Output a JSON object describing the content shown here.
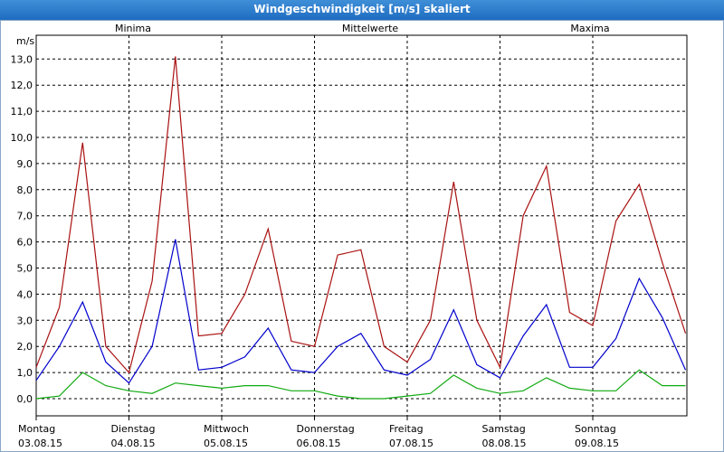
{
  "window": {
    "title": "Windgeschwindigkeit [m/s] skaliert"
  },
  "chart_data": {
    "type": "line",
    "title": "Windgeschwindigkeit [m/s] skaliert",
    "ylabel": "m/s",
    "ylim": [
      0,
      13.5
    ],
    "grid": true,
    "legend_position": "top",
    "y_ticks": [
      "0,0",
      "1,0",
      "2,0",
      "3,0",
      "4,0",
      "5,0",
      "6,0",
      "7,0",
      "8,0",
      "9,0",
      "10,0",
      "11,0",
      "12,0",
      "13,0"
    ],
    "x_labels": [
      {
        "day": "Montag",
        "date": "03.08.15"
      },
      {
        "day": "Dienstag",
        "date": "04.08.15"
      },
      {
        "day": "Mittwoch",
        "date": "05.08.15"
      },
      {
        "day": "Donnerstag",
        "date": "06.08.15"
      },
      {
        "day": "Freitag",
        "date": "07.08.15"
      },
      {
        "day": "Samstag",
        "date": "08.08.15"
      },
      {
        "day": "Sonntag",
        "date": "09.08.15"
      }
    ],
    "x": [
      "03.08.15 00:00",
      "03.08.15 06:00",
      "03.08.15 12:00",
      "03.08.15 18:00",
      "04.08.15 00:00",
      "04.08.15 06:00",
      "04.08.15 12:00",
      "04.08.15 18:00",
      "05.08.15 00:00",
      "05.08.15 06:00",
      "05.08.15 12:00",
      "05.08.15 18:00",
      "06.08.15 00:00",
      "06.08.15 06:00",
      "06.08.15 12:00",
      "06.08.15 18:00",
      "07.08.15 00:00",
      "07.08.15 06:00",
      "07.08.15 12:00",
      "07.08.15 18:00",
      "08.08.15 00:00",
      "08.08.15 06:00",
      "08.08.15 12:00",
      "08.08.15 18:00",
      "09.08.15 00:00",
      "09.08.15 06:00",
      "09.08.15 12:00",
      "09.08.15 18:00",
      "10.08.15 00:00"
    ],
    "series": [
      {
        "name": "Minima",
        "color": "#11aa11",
        "values": [
          0.0,
          0.1,
          1.0,
          0.5,
          0.3,
          0.2,
          0.6,
          0.5,
          0.4,
          0.5,
          0.5,
          0.3,
          0.3,
          0.1,
          0.0,
          0.0,
          0.1,
          0.2,
          0.9,
          0.4,
          0.2,
          0.3,
          0.8,
          0.4,
          0.3,
          0.3,
          1.1,
          0.5,
          0.5
        ]
      },
      {
        "name": "Mittelwerte",
        "color": "#0000cc",
        "values": [
          0.7,
          2.0,
          3.7,
          1.4,
          0.6,
          2.0,
          6.1,
          1.1,
          1.2,
          1.6,
          2.7,
          1.1,
          1.0,
          2.0,
          2.5,
          1.1,
          0.9,
          1.5,
          3.4,
          1.3,
          0.8,
          2.4,
          3.6,
          1.2,
          1.2,
          2.3,
          4.6,
          3.1,
          1.1
        ]
      },
      {
        "name": "Maxima",
        "color": "#aa1111",
        "values": [
          1.2,
          3.5,
          9.8,
          2.0,
          1.0,
          4.5,
          13.1,
          2.4,
          2.5,
          4.0,
          6.5,
          2.2,
          2.0,
          5.5,
          5.7,
          2.0,
          1.4,
          3.0,
          8.3,
          3.0,
          1.2,
          7.0,
          8.9,
          3.3,
          2.8,
          6.8,
          8.2,
          5.2,
          2.5
        ]
      }
    ]
  }
}
